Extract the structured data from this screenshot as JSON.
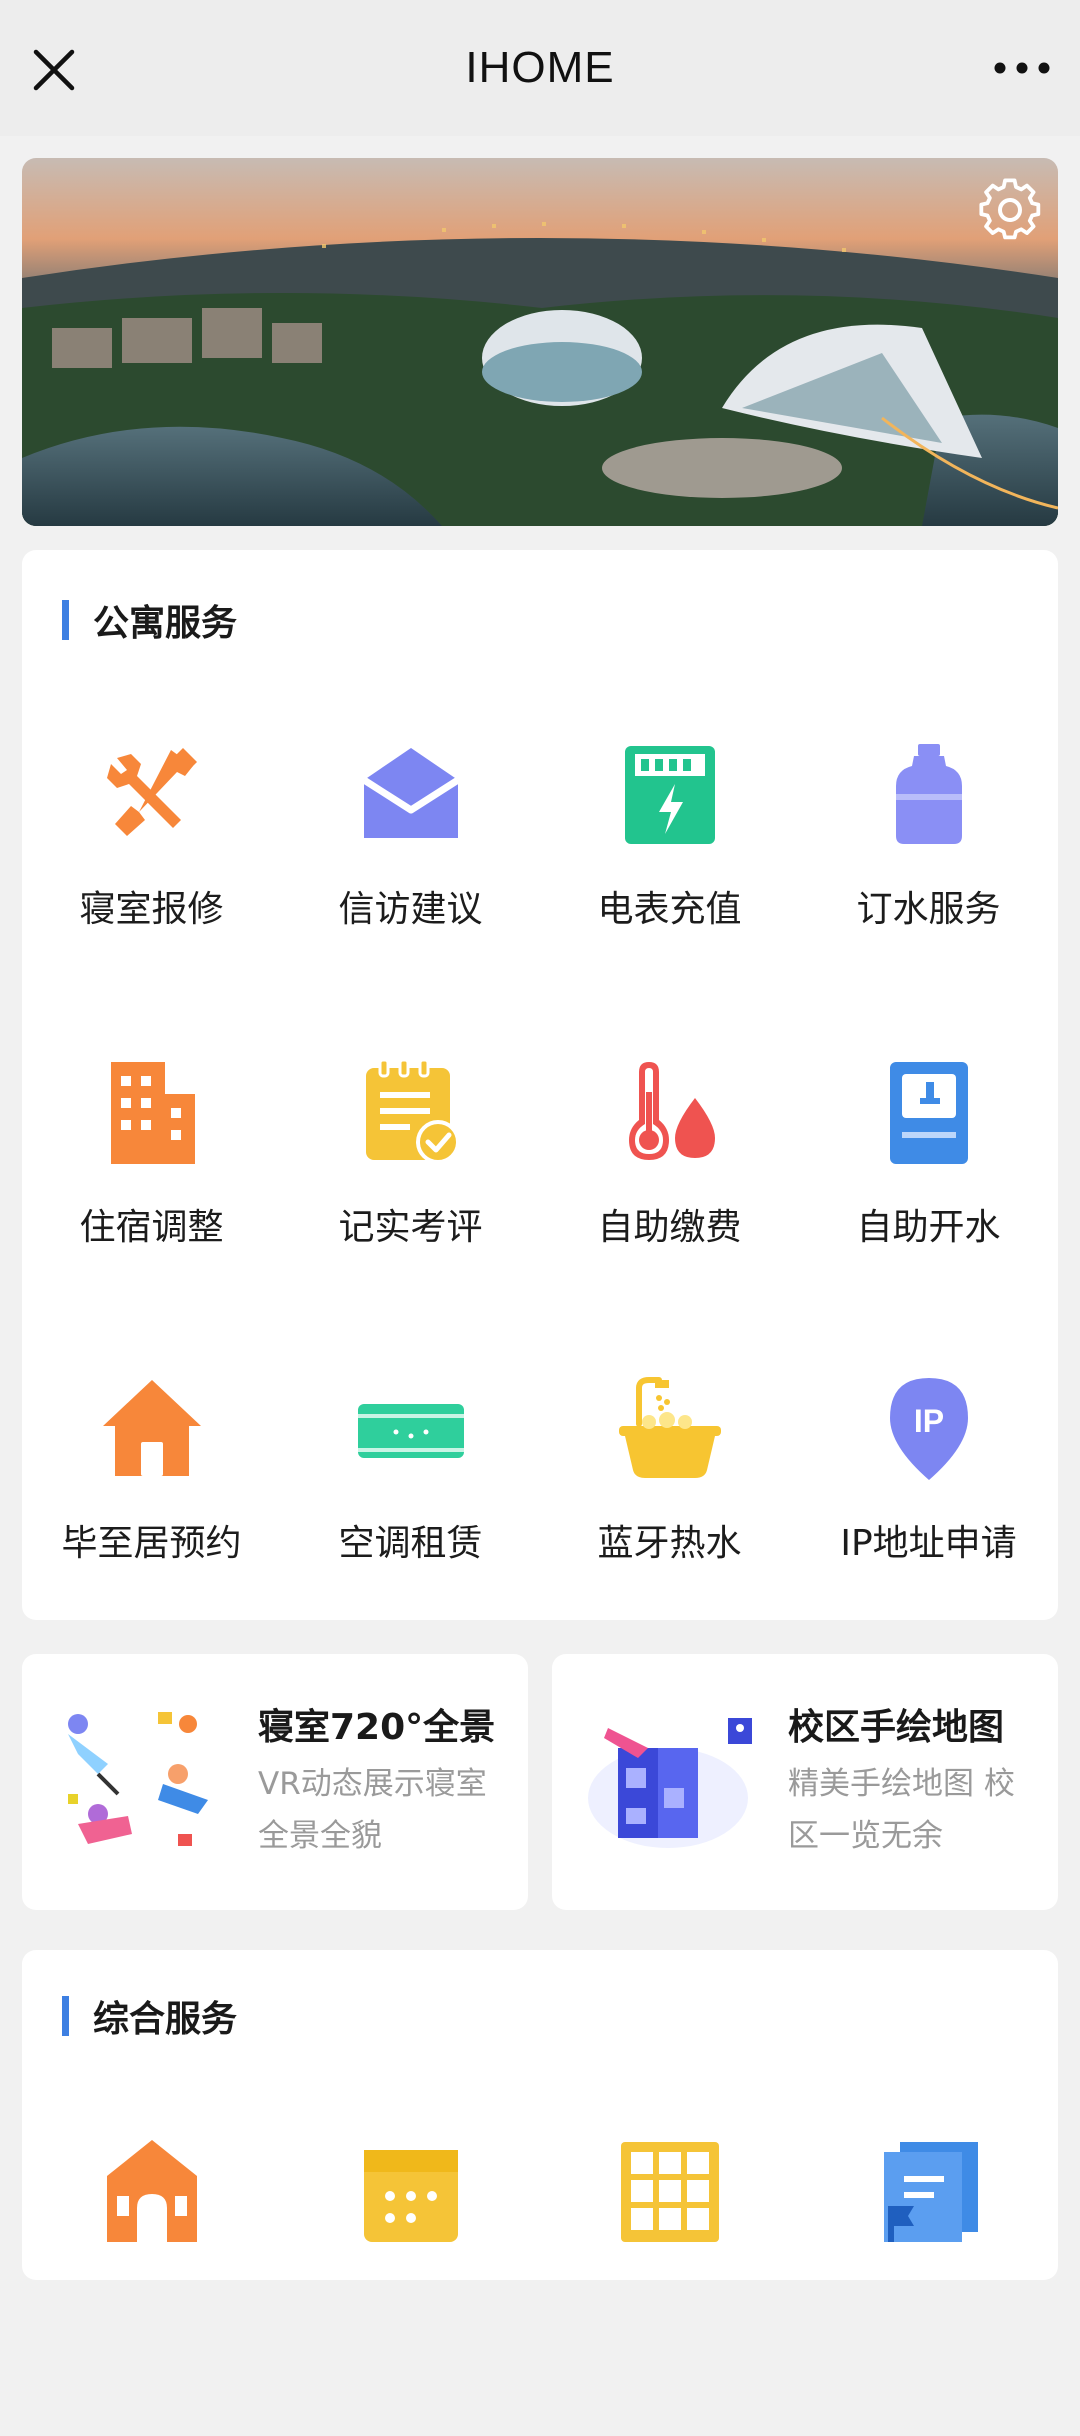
{
  "topbar": {
    "title": "IHOME",
    "close_icon": "close-icon",
    "more_icon": "more-icon"
  },
  "banner": {
    "image": "campus-aerial-photo",
    "settings_icon": "gear-icon"
  },
  "apartment": {
    "title": "公寓服务",
    "items": [
      {
        "label": "寝室报修",
        "icon": "wrench-screwdriver-icon",
        "color": "#f7873a"
      },
      {
        "label": "信访建议",
        "icon": "envelope-icon",
        "color": "#7d86f2"
      },
      {
        "label": "电表充值",
        "icon": "electric-meter-icon",
        "color": "#22c48e"
      },
      {
        "label": "订水服务",
        "icon": "water-bottle-icon",
        "color": "#8a8ff5"
      },
      {
        "label": "住宿调整",
        "icon": "building-icon",
        "color": "#f7873a"
      },
      {
        "label": "记实考评",
        "icon": "notepad-check-icon",
        "color": "#f5c437"
      },
      {
        "label": "自助缴费",
        "icon": "thermometer-drop-icon",
        "color": "#ef5350"
      },
      {
        "label": "自助开水",
        "icon": "water-dispenser-icon",
        "color": "#3f8be6"
      },
      {
        "label": "毕至居预约",
        "icon": "house-icon",
        "color": "#f7873a"
      },
      {
        "label": "空调租赁",
        "icon": "air-conditioner-icon",
        "color": "#2fcf9c"
      },
      {
        "label": "蓝牙热水",
        "icon": "bathtub-icon",
        "color": "#f7c531"
      },
      {
        "label": "IP地址申请",
        "icon": "ip-location-icon",
        "color": "#7d86f2"
      }
    ]
  },
  "promos": [
    {
      "title": "寝室720°全景",
      "desc": "VR动态展示寝室全景全貌",
      "icon": "vr-people-illustration"
    },
    {
      "title": "校区手绘地图",
      "desc": "精美手绘地图 校区一览无余",
      "icon": "map-puzzle-illustration"
    }
  ],
  "general": {
    "title": "综合服务",
    "items": [
      {
        "icon": "gate-icon",
        "color": "#f7873a"
      },
      {
        "icon": "calendar-icon",
        "color": "#f5c437"
      },
      {
        "icon": "grid-window-icon",
        "color": "#f5c437"
      },
      {
        "icon": "book-flag-icon",
        "color": "#3f8be6"
      }
    ]
  }
}
